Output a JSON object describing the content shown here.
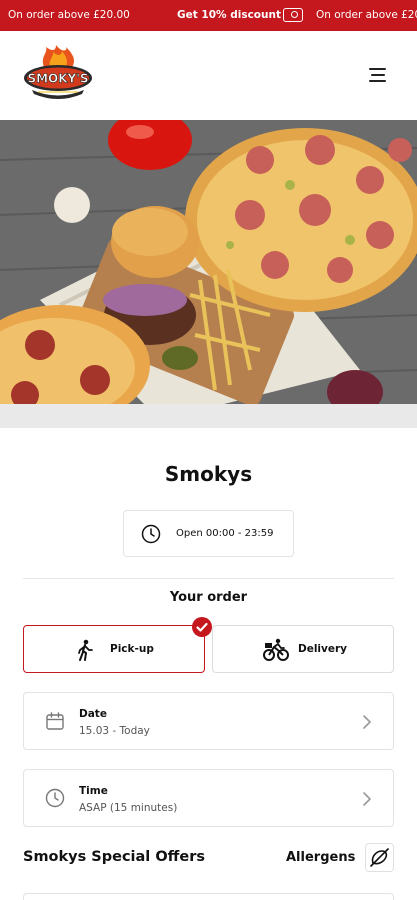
{
  "promo": {
    "item1": "On order above £20.00",
    "item2": "Get 10% discount",
    "item3": "On order above £20.00"
  },
  "header": {
    "logo_text": "SMOKY'S"
  },
  "store": {
    "name": "Smokys",
    "hours": "Open 00:00 - 23:59"
  },
  "order": {
    "heading": "Your order",
    "pickup_label": "Pick-up",
    "delivery_label": "Delivery",
    "selected": "Pick-up",
    "date_title": "Date",
    "date_value": "15.03 - Today",
    "time_title": "Time",
    "time_value": "ASAP (15 minutes)"
  },
  "offers": {
    "title": "Smokys Special Offers",
    "allergens_label": "Allergens"
  },
  "colors": {
    "brand_red": "#c4171e",
    "text": "#111111",
    "muted": "#555555",
    "border": "#e3e3e3"
  },
  "icons": [
    "ticket-icon",
    "menu-icon",
    "clock-icon",
    "walking-person-icon",
    "bicycle-icon",
    "check-icon",
    "calendar-icon",
    "chevron-right-icon",
    "allergens-icon"
  ]
}
